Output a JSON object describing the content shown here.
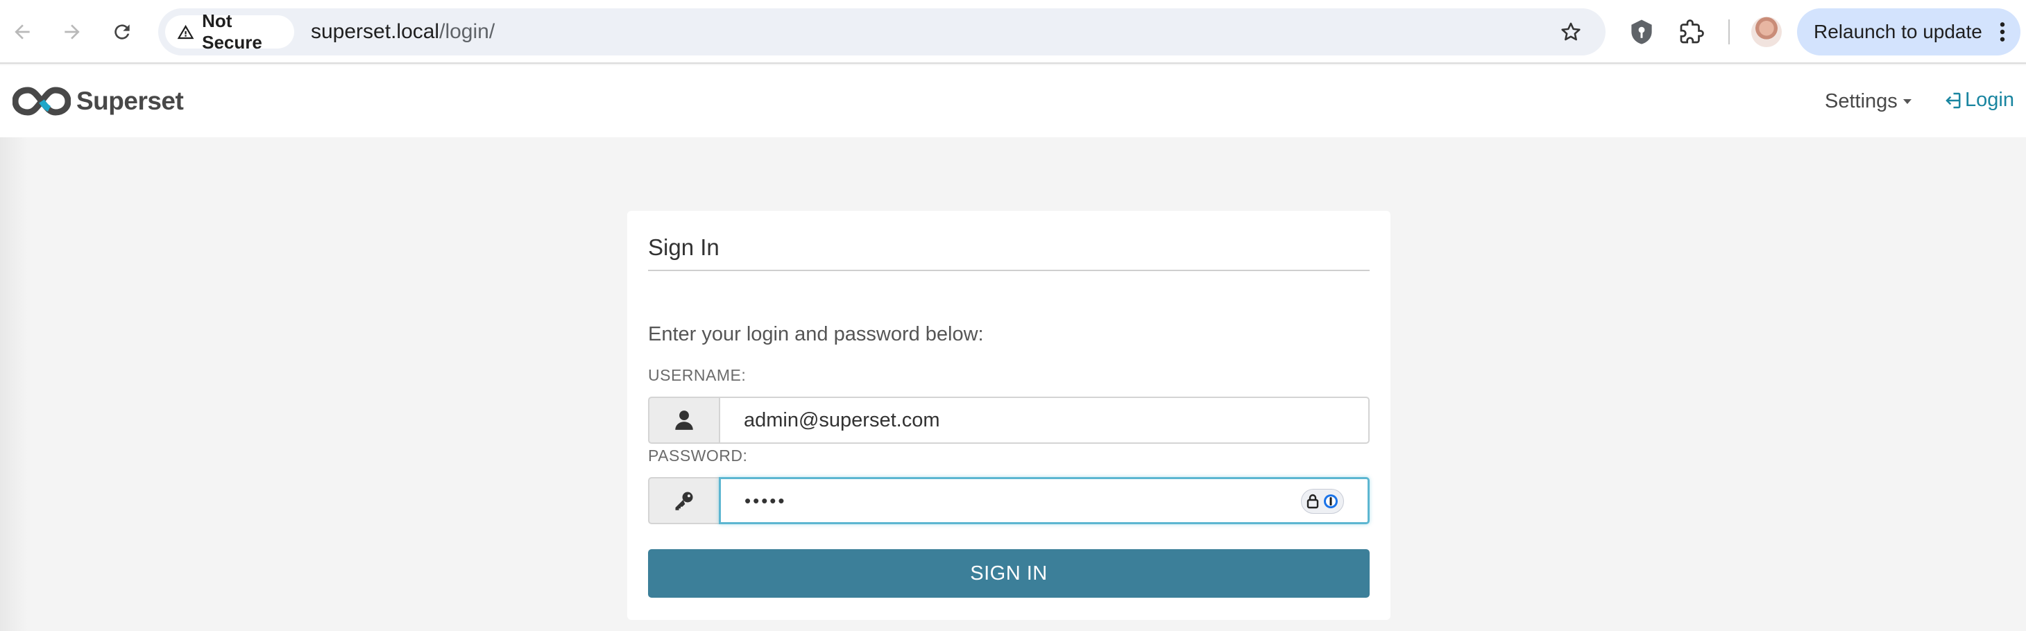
{
  "browser": {
    "security_label": "Not Secure",
    "url_host": "superset.local",
    "url_path": "/login/",
    "relaunch_label": "Relaunch to update",
    "icons": [
      "back-arrow-icon",
      "forward-arrow-icon",
      "reload-icon",
      "warning-icon",
      "star-icon",
      "shield-extension-icon",
      "puzzle-icon",
      "kebab-menu-icon"
    ]
  },
  "navbar": {
    "brand": "Superset",
    "settings_label": "Settings",
    "login_label": "Login"
  },
  "login_panel": {
    "title": "Sign In",
    "instructions": "Enter your login and password below:",
    "username_label": "USERNAME:",
    "username_value": "admin@superset.com",
    "password_label": "PASSWORD:",
    "password_masked": "•••••",
    "submit_label": "SIGN IN"
  },
  "colors": {
    "accent": "#1985a0",
    "button": "#3c7f99",
    "focus_ring": "#5cb6d1",
    "relaunch_bg": "#d3e3fd"
  }
}
